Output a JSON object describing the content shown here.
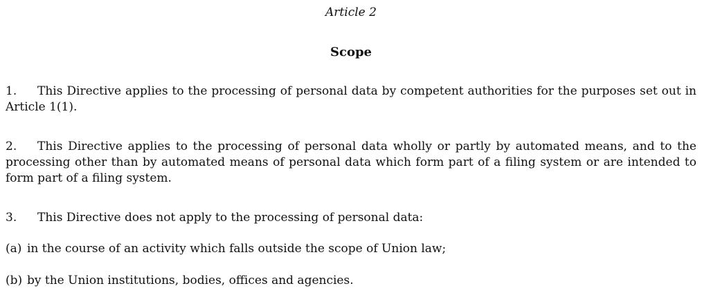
{
  "article": {
    "number_label": "Article 2",
    "title": "Scope"
  },
  "paragraphs": [
    {
      "number": "1.",
      "text": "This Directive applies to the processing of personal data by competent authorities for the purposes set out in Article 1(1)."
    },
    {
      "number": "2.",
      "text": "This Directive applies to the processing of personal data wholly or partly by automated means, and to the processing other than by automated means of personal data which form part of a filing system or are intended to form part of a filing system."
    },
    {
      "number": "3.",
      "text": "This Directive does not apply to the processing of personal data:"
    }
  ],
  "items": [
    {
      "label": "(a)",
      "text": "in the course of an activity which falls outside the scope of Union law;"
    },
    {
      "label": "(b)",
      "text": "by the Union institutions, bodies, offices and agencies."
    }
  ]
}
